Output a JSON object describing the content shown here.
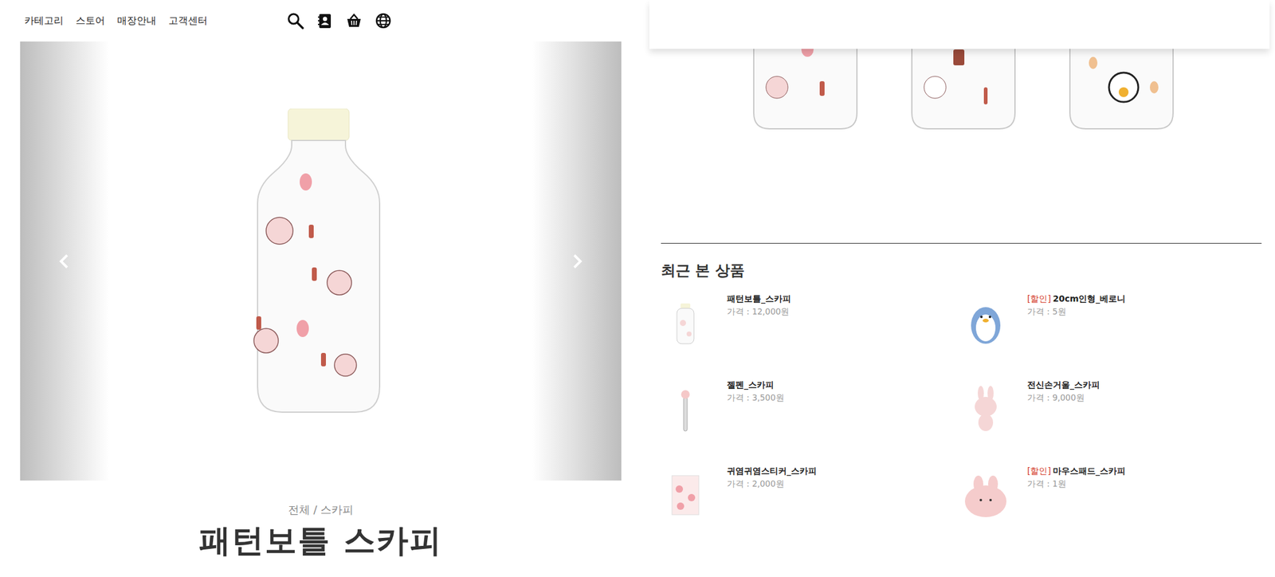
{
  "nav": {
    "items": [
      "카테고리",
      "스토어",
      "매장안내",
      "고객센터"
    ]
  },
  "product": {
    "breadcrumb": "전체 / 스카피",
    "title": "패턴보틀 스카피"
  },
  "recent": {
    "heading": "최근 본 상품",
    "items": [
      {
        "badge": "",
        "name": "패턴보틀_스카피",
        "price": "가격 : 12,000원",
        "kind": "bottle"
      },
      {
        "badge": "[할인]",
        "name": "20cm인형_베로니",
        "price": "가격 : 5원",
        "kind": "penguin"
      },
      {
        "badge": "",
        "name": "젤펜_스카피",
        "price": "가격 : 3,500원",
        "kind": "pen"
      },
      {
        "badge": "",
        "name": "전신손거울_스카피",
        "price": "가격 : 9,000원",
        "kind": "bunny"
      },
      {
        "badge": "",
        "name": "귀염귀염스티커_스카피",
        "price": "가격 : 2,000원",
        "kind": "sticker"
      },
      {
        "badge": "[할인]",
        "name": "마우스패드_스카피",
        "price": "가격 : 1원",
        "kind": "pad"
      }
    ]
  }
}
